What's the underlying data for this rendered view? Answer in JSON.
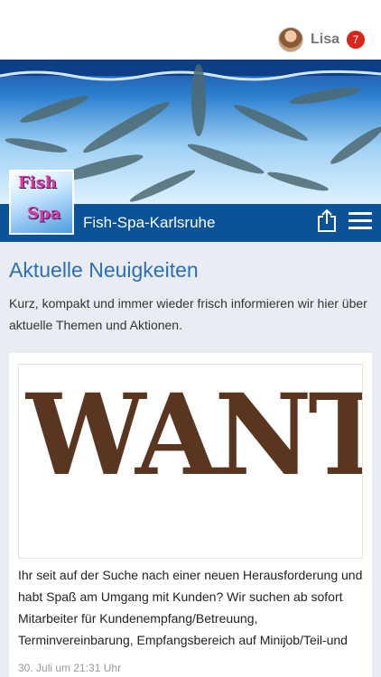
{
  "header": {
    "username": "Lisa",
    "notification_count": "7"
  },
  "brand": {
    "name": "Fish-Spa-Karlsruhe",
    "logo_line1": "Fish",
    "logo_line2": "Spa"
  },
  "news": {
    "title": "Aktuelle Neuigkeiten",
    "intro": "Kurz, kompakt und immer wieder frisch informieren wir hier über aktuelle Themen und Aktionen.",
    "post": {
      "image_text": "WANTED",
      "text": "Ihr seit auf der Suche nach einer neuen Herausforderung und habt Spaß am Umgang mit Kunden? Wir suchen ab sofort Mitarbeiter für Kundenempfang/Betreuung, Terminvereinbarung, Empfangsbereich auf Minijob/Teil-und",
      "date": "30. Juli um 21:31 Uhr"
    }
  },
  "colors": {
    "brand_bar": "#0a5399",
    "title": "#2c6fb3",
    "badge": "#d9261c"
  }
}
